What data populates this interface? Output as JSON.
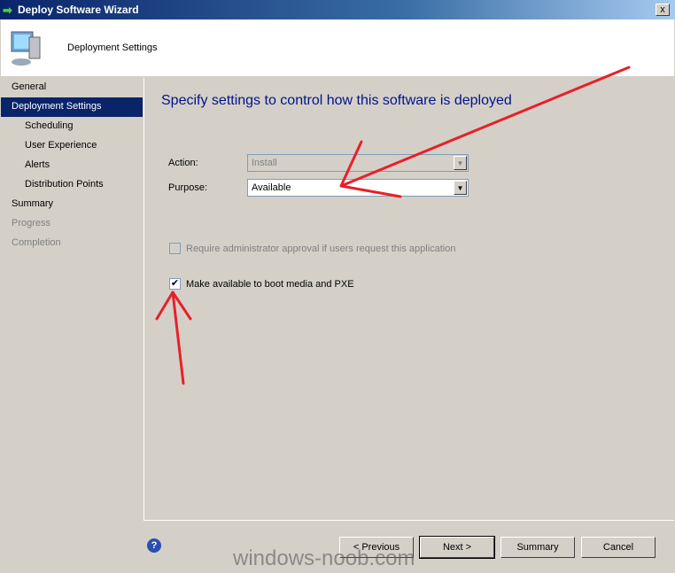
{
  "window": {
    "title": "Deploy Software Wizard",
    "close": "x"
  },
  "header": {
    "title": "Deployment Settings"
  },
  "sidebar": {
    "items": [
      {
        "label": "General"
      },
      {
        "label": "Deployment Settings"
      },
      {
        "label": "Scheduling"
      },
      {
        "label": "User Experience"
      },
      {
        "label": "Alerts"
      },
      {
        "label": "Distribution Points"
      },
      {
        "label": "Summary"
      },
      {
        "label": "Progress"
      },
      {
        "label": "Completion"
      }
    ]
  },
  "main": {
    "heading": "Specify settings to control how this software is deployed",
    "action_label": "Action:",
    "action_value": "Install",
    "purpose_label": "Purpose:",
    "purpose_value": "Available",
    "approval_label": "Require administrator approval if users request this application",
    "approval_checked": false,
    "pxe_label": "Make available to boot media and PXE",
    "pxe_checked": true
  },
  "buttons": {
    "previous": "< Previous",
    "next": "Next >",
    "summary": "Summary",
    "cancel": "Cancel",
    "help": "?"
  },
  "watermark": "windows-noob.com",
  "colors": {
    "annotation": "#e8202a",
    "selection": "#0a246a",
    "heading": "#00148c"
  }
}
